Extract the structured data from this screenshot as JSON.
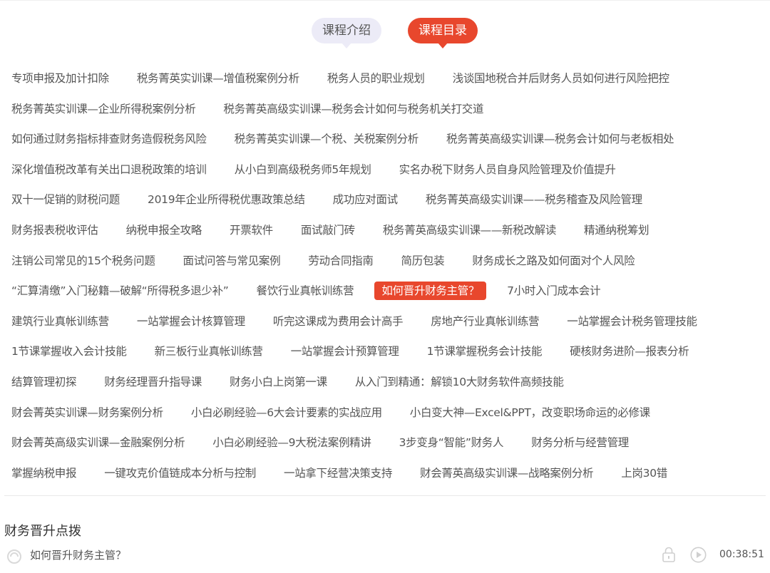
{
  "tabs": {
    "intro": "课程介绍",
    "catalog": "课程目录"
  },
  "course_rows": [
    [
      "专项申报及加计扣除",
      "税务菁英实训课—增值税案例分析",
      "税务人员的职业规划",
      "浅谈国地税合并后财务人员如何进行风险把控"
    ],
    [
      "税务菁英实训课—企业所得税案例分析",
      "税务菁英高级实训课—税务会计如何与税务机关打交道"
    ],
    [
      "如何通过财务指标排查财务造假税务风险",
      "税务菁英实训课—个税、关税案例分析",
      "税务菁英高级实训课—税务会计如何与老板相处"
    ],
    [
      "深化增值税改革有关出口退税政策的培训",
      "从小白到高级税务师5年规划",
      "实名办税下财务人员自身风险管理及价值提升"
    ],
    [
      "双十一促销的财税问题",
      "2019年企业所得税优惠政策总结",
      "成功应对面试",
      "税务菁英高级实训课——税务稽查及风险管理"
    ],
    [
      "财务报表税收评估",
      "纳税申报全攻略",
      "开票软件",
      "面试敲门砖",
      "税务菁英高级实训课——新税改解读",
      "精通纳税筹划"
    ],
    [
      "注销公司常见的15个税务问题",
      "面试问答与常见案例",
      "劳动合同指南",
      "简历包装",
      "财务成长之路及如何面对个人风险"
    ],
    [
      "“汇算清缴”入门秘籍—破解“所得税多退少补”",
      "餐饮行业真帐训练营",
      "如何晋升财务主管？",
      "7小时入门成本会计"
    ],
    [
      "建筑行业真帐训练营",
      "一站掌握会计核算管理",
      "听完这课成为费用会计高手",
      "房地产行业真帐训练营",
      "一站掌握会计税务管理技能"
    ],
    [
      "1节课掌握收入会计技能",
      "新三板行业真帐训练营",
      "一站掌握会计预算管理",
      "1节课掌握税务会计技能",
      "硬核财务进阶—报表分析"
    ],
    [
      "结算管理初探",
      "财务经理晋升指导课",
      "财务小白上岗第一课",
      "从入门到精通：解锁10大财务软件高频技能"
    ],
    [
      "财会菁英实训课—财务案例分析",
      "小白必刷经验—6大会计要素的实战应用",
      "小白变大神—Excel&PPT，改变职场命运的必修课"
    ],
    [
      "财会菁英高级实训课—金融案例分析",
      "小白必刷经验—9大税法案例精讲",
      "3步变身“智能”财务人",
      "财务分析与经营管理"
    ],
    [
      "掌握纳税申报",
      "一键攻克价值链成本分析与控制",
      "一站拿下经营决策支持",
      "财会菁英高级实训课—战略案例分析",
      "上岗30错"
    ]
  ],
  "active_course": "如何晋升财务主管？",
  "section": {
    "title": "财务晋升点拨",
    "lesson": {
      "title": "如何晋升财务主管？",
      "duration": "00:38:51"
    }
  },
  "colors": {
    "accent": "#e8472d",
    "tab_inactive_bg": "#ecebf7",
    "text": "#555555"
  }
}
